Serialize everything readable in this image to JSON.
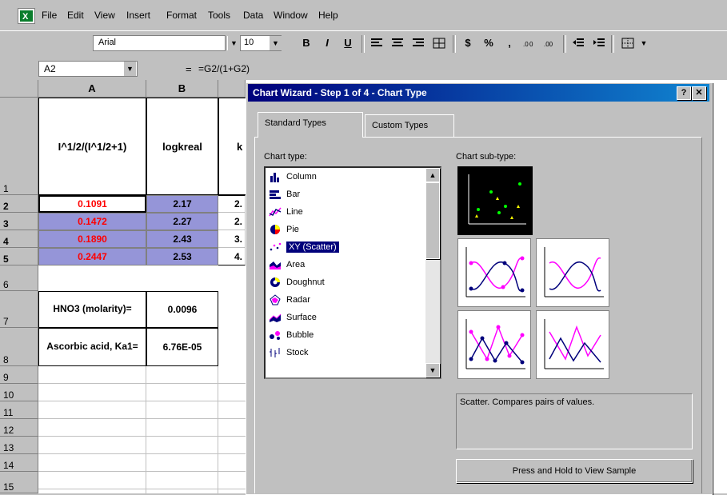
{
  "menu": [
    "File",
    "Edit",
    "View",
    "Insert",
    "Format",
    "Tools",
    "Data",
    "Window",
    "Help"
  ],
  "toolbar": {
    "font": "Arial",
    "size": "10",
    "buttons": [
      "B",
      "I",
      "U",
      "$",
      "%",
      ","
    ]
  },
  "formula_bar": {
    "cell_ref": "A2",
    "eq": "=",
    "formula": "=G2/(1+G2)"
  },
  "sheet": {
    "columns": [
      "A",
      "B"
    ],
    "rows": [
      "1",
      "2",
      "3",
      "4",
      "5",
      "6",
      "7",
      "8",
      "9",
      "10",
      "11",
      "12",
      "13",
      "14",
      "15"
    ],
    "a1": "I^1/2/(I^1/2+1)",
    "b1": "logkreal",
    "c1_partial": "k",
    "data": [
      {
        "a": "0.1091",
        "b": "2.17",
        "c": "2."
      },
      {
        "a": "0.1472",
        "b": "2.27",
        "c": "2."
      },
      {
        "a": "0.1890",
        "b": "2.43",
        "c": "3."
      },
      {
        "a": "0.2447",
        "b": "2.53",
        "c": "4."
      }
    ],
    "a7": "HNO3 (molarity)=",
    "b7": "0.0096",
    "a8": "Ascorbic acid, Ka1=",
    "b8": "6.76E-05"
  },
  "dialog": {
    "title": "Chart Wizard - Step 1 of 4 - Chart Type",
    "help_btn": "?",
    "close_btn": "✕",
    "tabs": [
      "Standard Types",
      "Custom Types"
    ],
    "chart_type_label": "Chart type:",
    "subtype_label": "Chart sub-type:",
    "chart_types": [
      "Column",
      "Bar",
      "Line",
      "Pie",
      "XY (Scatter)",
      "Area",
      "Doughnut",
      "Radar",
      "Surface",
      "Bubble",
      "Stock"
    ],
    "selected_type": "XY (Scatter)",
    "description": "Scatter. Compares pairs of values.",
    "press_button": "Press and Hold to View Sample"
  }
}
